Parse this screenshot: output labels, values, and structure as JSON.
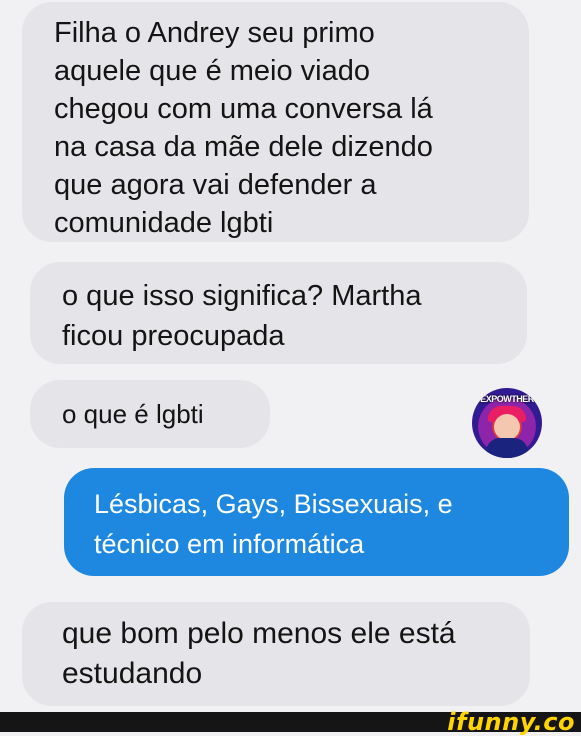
{
  "messages": [
    {
      "text": "Filha o Andrey seu primo\naquele que é meio viado\nchegou com uma conversa lá\nna casa da mãe dele dizendo\nque agora vai defender a\ncomunidade lgbti"
    },
    {
      "text": "o que isso significa? Martha\nficou preocupada"
    },
    {
      "text": "o que é lgbti"
    },
    {
      "text": "Lésbicas, Gays, Bissexuais, e\ntécnico em informática"
    },
    {
      "text": "que bom pelo menos ele está\nestudando"
    }
  ],
  "avatar": {
    "label": "EXPOWTHER"
  },
  "watermark": "ifunny.co",
  "colors": {
    "incoming_bubble": "#e5e5e9",
    "outgoing_bubble": "#1e88e0",
    "background": "#f1f1f3"
  }
}
